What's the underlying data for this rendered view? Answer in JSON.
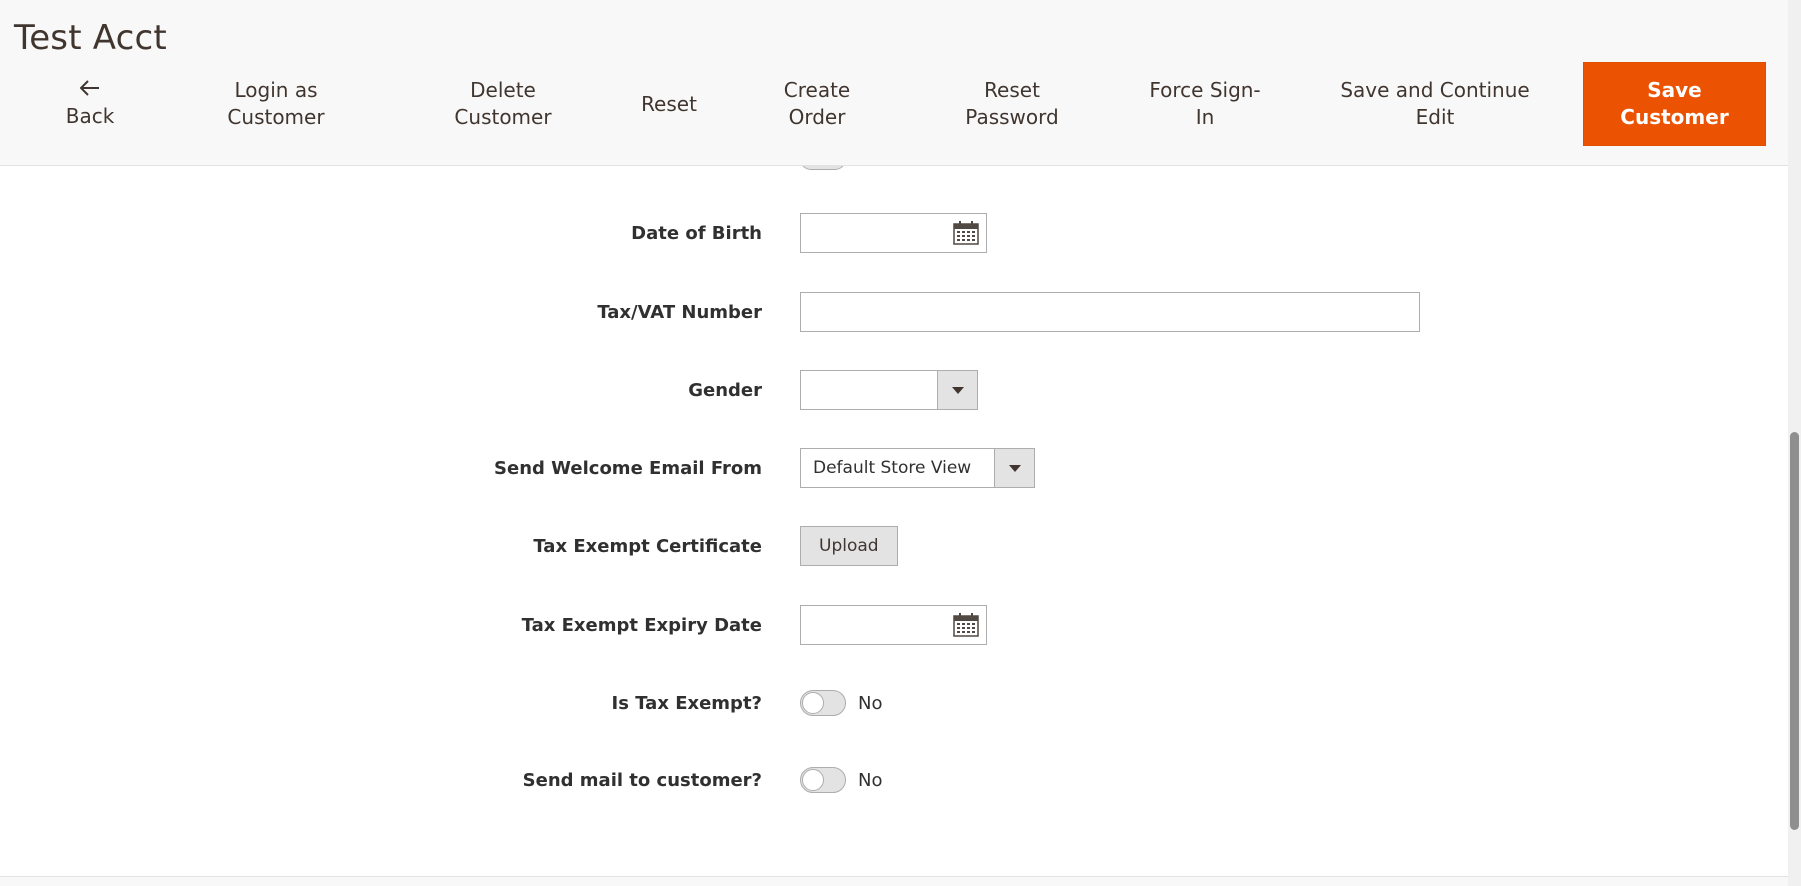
{
  "page": {
    "title": "Test Acct"
  },
  "actions": {
    "back": "Back",
    "login_as_customer_l1": "Login as",
    "login_as_customer_l2": "Customer",
    "delete_customer_l1": "Delete",
    "delete_customer_l2": "Customer",
    "reset": "Reset",
    "create_order_l1": "Create",
    "create_order_l2": "Order",
    "reset_password_l1": "Reset",
    "reset_password_l2": "Password",
    "force_signin_l1": "Force Sign-",
    "force_signin_l2": "In",
    "save_continue_l1": "Save and Continue",
    "save_continue_l2": "Edit",
    "save_customer_l1": "Save",
    "save_customer_l2": "Customer"
  },
  "form": {
    "dob": {
      "label": "Date of Birth",
      "value": ""
    },
    "taxvat": {
      "label": "Tax/VAT Number",
      "value": ""
    },
    "gender": {
      "label": "Gender",
      "selected": ""
    },
    "welcome_email": {
      "label": "Send Welcome Email From",
      "selected": "Default Store View"
    },
    "tax_cert": {
      "label": "Tax Exempt Certificate",
      "button": "Upload"
    },
    "tax_expiry": {
      "label": "Tax Exempt Expiry Date",
      "value": ""
    },
    "is_tax_exempt": {
      "label": "Is Tax Exempt?",
      "state": "No"
    },
    "send_mail": {
      "label": "Send mail to customer?",
      "state": "No"
    }
  },
  "colors": {
    "primary": "#eb5202",
    "header_bg": "#f8f8f8",
    "text": "#303030"
  }
}
